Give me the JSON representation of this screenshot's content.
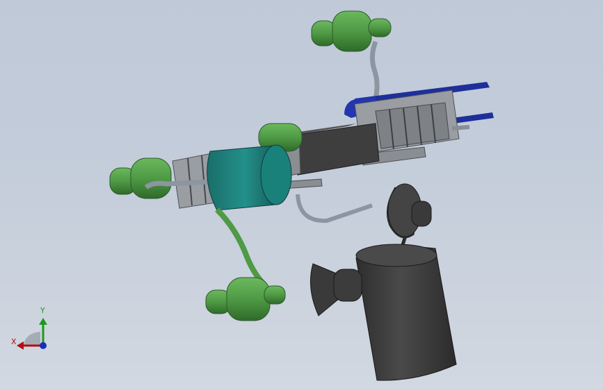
{
  "viewport": {
    "background_top": "#bfc9d8",
    "background_bottom": "#d2d8e1"
  },
  "model": {
    "colors": {
      "green_part": "#4f9a45",
      "green_shade": "#3c7a35",
      "teal_cylinder": "#1f7f7a",
      "dark_gray": "#3e3e3e",
      "frame_gray": "#8a8d92",
      "blue_part": "#1e2f9a",
      "tube_gray": "#8c95a0"
    },
    "icons": [
      "green-hose-nozzle",
      "teal-cylinder",
      "dark-cylinder",
      "cone-speaker",
      "blue-rail",
      "frame-structure"
    ]
  },
  "triad": {
    "x_label": "X",
    "y_label": "Y",
    "x_color": "#b01010",
    "y_color": "#1a9a1a",
    "z_color": "#1b2fb8"
  }
}
